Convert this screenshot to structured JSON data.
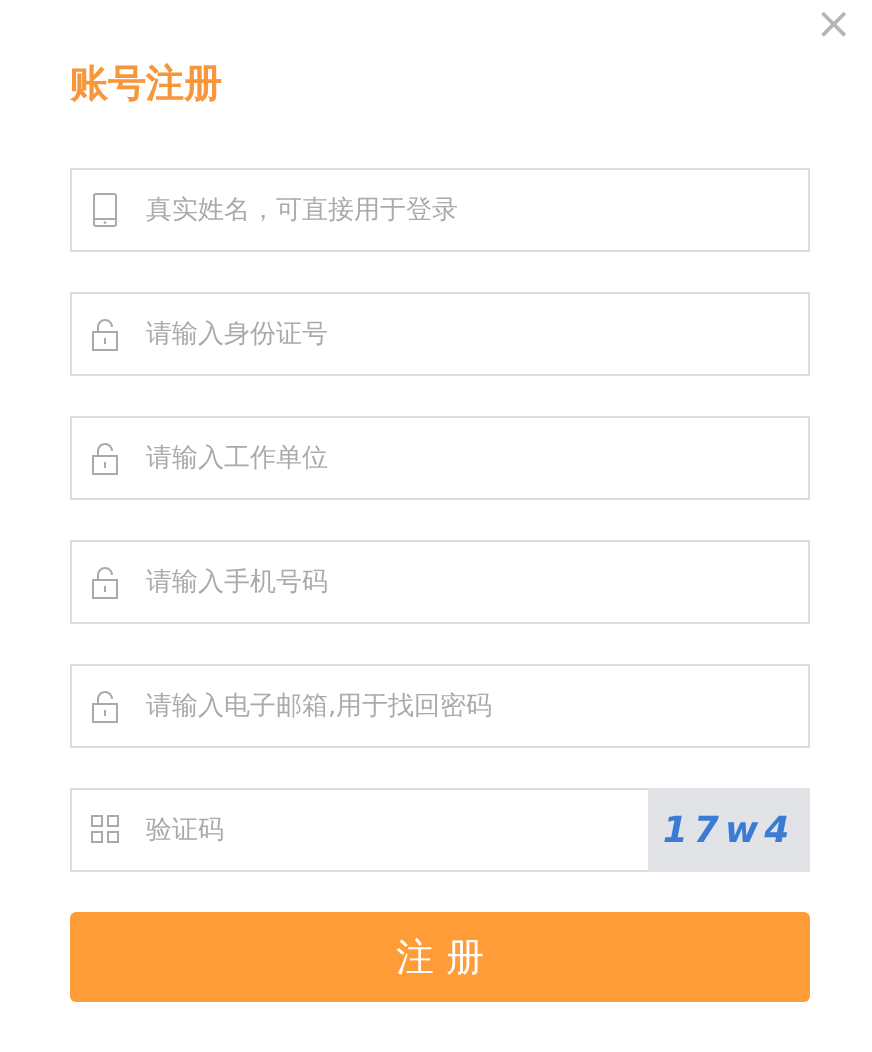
{
  "dialog": {
    "title": "账号注册",
    "close": "×"
  },
  "fields": [
    {
      "kind": "phone",
      "placeholder": "真实姓名，可直接用于登录"
    },
    {
      "kind": "lock",
      "placeholder": "请输入身份证号"
    },
    {
      "kind": "lock",
      "placeholder": "请输入工作单位"
    },
    {
      "kind": "lock",
      "placeholder": "请输入手机号码"
    },
    {
      "kind": "lock",
      "placeholder": "请输入电子邮箱,用于找回密码"
    },
    {
      "kind": "code",
      "placeholder": "验证码",
      "captcha": "17w4"
    }
  ],
  "submit": "注 册"
}
